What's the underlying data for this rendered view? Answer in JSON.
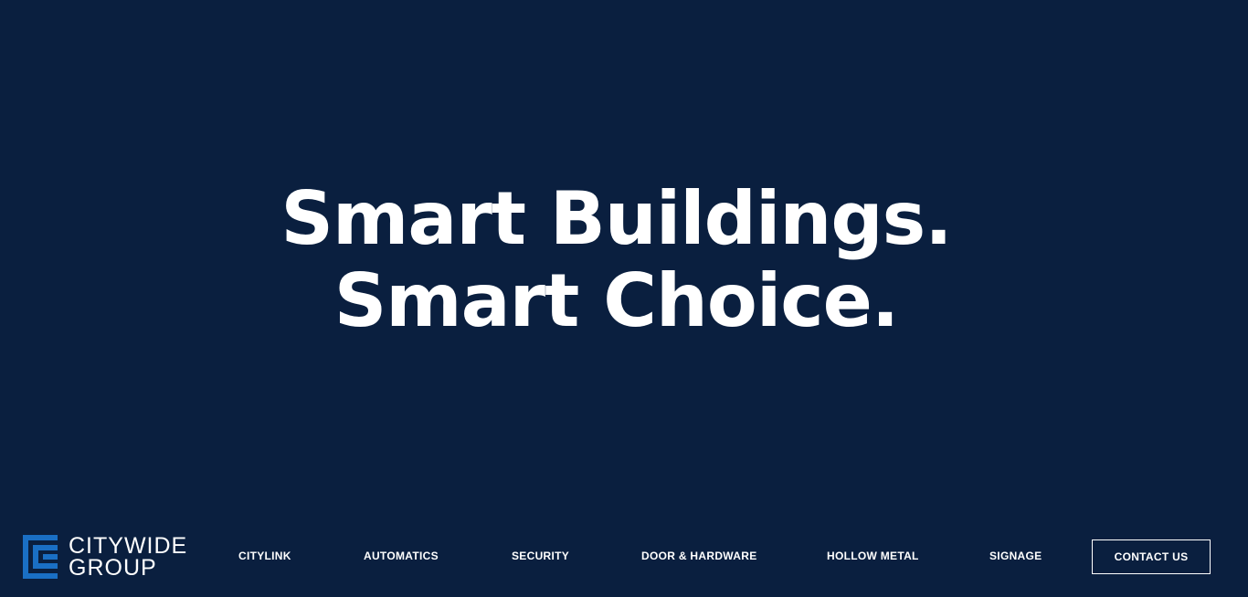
{
  "hero": {
    "line1": "Smart Buildings.",
    "line2": "Smart Choice."
  },
  "logo": {
    "line1": "CITYWIDE",
    "line2": "GROUP",
    "icon": "citywide-c-mark-icon",
    "color": "#1a6fc4"
  },
  "nav": {
    "items": [
      {
        "label": "CITYLINK"
      },
      {
        "label": "AUTOMATICS"
      },
      {
        "label": "SECURITY"
      },
      {
        "label": "DOOR & HARDWARE"
      },
      {
        "label": "HOLLOW METAL"
      },
      {
        "label": "SIGNAGE"
      }
    ],
    "contact_label": "CONTACT US"
  },
  "colors": {
    "background": "#0a1f3f",
    "text": "#ffffff",
    "accent": "#1a6fc4"
  }
}
